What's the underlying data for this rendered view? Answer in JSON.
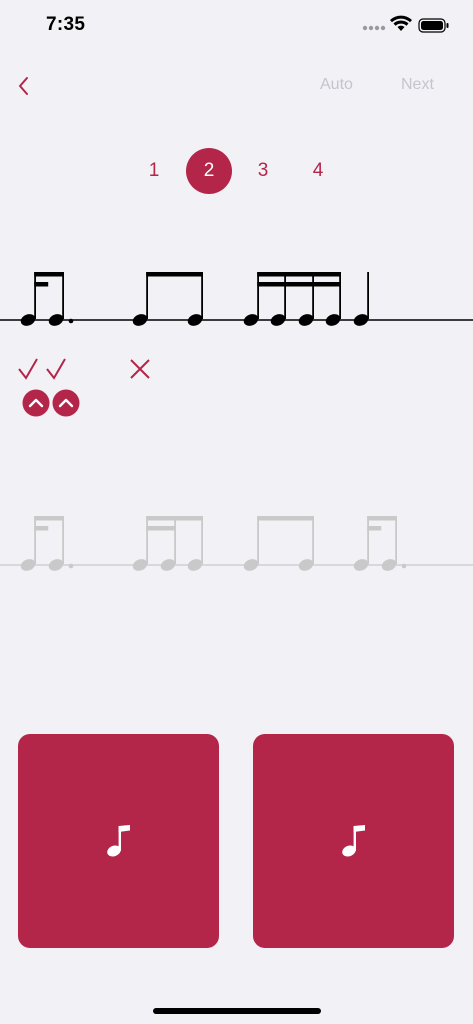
{
  "status_bar": {
    "time": "7:35"
  },
  "nav": {
    "auto_label": "Auto",
    "next_label": "Next"
  },
  "pages": [
    {
      "label": "1",
      "active": false
    },
    {
      "label": "2",
      "active": true
    },
    {
      "label": "3",
      "active": false
    },
    {
      "label": "4",
      "active": false
    }
  ],
  "answer_staff": {
    "groups": [
      {
        "rhythm": "sixteenth-dotted-eighth",
        "result": "correct"
      },
      {
        "rhythm": "two-eighths",
        "result": "incorrect"
      },
      {
        "rhythm": "four-sixteenths",
        "result": "none"
      },
      {
        "rhythm": "quarter",
        "result": "none"
      }
    ]
  },
  "reference_staff": {
    "groups": [
      {
        "rhythm": "sixteenth-dotted-eighth"
      },
      {
        "rhythm": "two-sixteenths-eighth"
      },
      {
        "rhythm": "two-eighths"
      },
      {
        "rhythm": "sixteenth-dotted-eighth"
      }
    ]
  },
  "answer_buttons": [
    {
      "icon": "music-note-icon"
    },
    {
      "icon": "music-note-icon"
    }
  ],
  "colors": {
    "accent": "#b3264a",
    "background": "#f2f1f6",
    "faded_note": "#c9c9c9"
  }
}
